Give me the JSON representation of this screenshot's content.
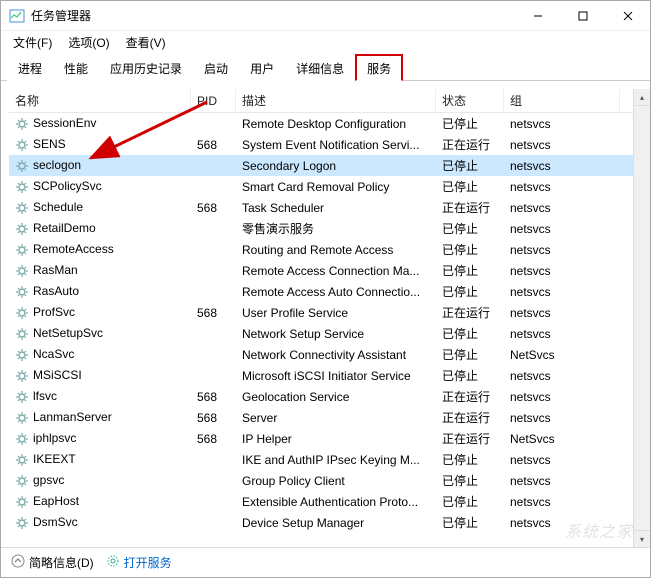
{
  "window": {
    "title": "任务管理器"
  },
  "menubar": {
    "file": "文件(F)",
    "options": "选项(O)",
    "view": "查看(V)"
  },
  "tabs": {
    "process": "进程",
    "performance": "性能",
    "apphistory": "应用历史记录",
    "startup": "启动",
    "users": "用户",
    "details": "详细信息",
    "services": "服务"
  },
  "columns": {
    "name": "名称",
    "pid": "PID",
    "desc": "描述",
    "status": "状态",
    "group": "组"
  },
  "services": [
    {
      "name": "SessionEnv",
      "pid": "",
      "desc": "Remote Desktop Configuration",
      "status": "已停止",
      "group": "netsvcs"
    },
    {
      "name": "SENS",
      "pid": "568",
      "desc": "System Event Notification Servi...",
      "status": "正在运行",
      "group": "netsvcs"
    },
    {
      "name": "seclogon",
      "pid": "",
      "desc": "Secondary Logon",
      "status": "已停止",
      "group": "netsvcs",
      "selected": true
    },
    {
      "name": "SCPolicySvc",
      "pid": "",
      "desc": "Smart Card Removal Policy",
      "status": "已停止",
      "group": "netsvcs"
    },
    {
      "name": "Schedule",
      "pid": "568",
      "desc": "Task Scheduler",
      "status": "正在运行",
      "group": "netsvcs"
    },
    {
      "name": "RetailDemo",
      "pid": "",
      "desc": "零售演示服务",
      "status": "已停止",
      "group": "netsvcs"
    },
    {
      "name": "RemoteAccess",
      "pid": "",
      "desc": "Routing and Remote Access",
      "status": "已停止",
      "group": "netsvcs"
    },
    {
      "name": "RasMan",
      "pid": "",
      "desc": "Remote Access Connection Ma...",
      "status": "已停止",
      "group": "netsvcs"
    },
    {
      "name": "RasAuto",
      "pid": "",
      "desc": "Remote Access Auto Connectio...",
      "status": "已停止",
      "group": "netsvcs"
    },
    {
      "name": "ProfSvc",
      "pid": "568",
      "desc": "User Profile Service",
      "status": "正在运行",
      "group": "netsvcs"
    },
    {
      "name": "NetSetupSvc",
      "pid": "",
      "desc": "Network Setup Service",
      "status": "已停止",
      "group": "netsvcs"
    },
    {
      "name": "NcaSvc",
      "pid": "",
      "desc": "Network Connectivity Assistant",
      "status": "已停止",
      "group": "NetSvcs"
    },
    {
      "name": "MSiSCSI",
      "pid": "",
      "desc": "Microsoft iSCSI Initiator Service",
      "status": "已停止",
      "group": "netsvcs"
    },
    {
      "name": "lfsvc",
      "pid": "568",
      "desc": "Geolocation Service",
      "status": "正在运行",
      "group": "netsvcs"
    },
    {
      "name": "LanmanServer",
      "pid": "568",
      "desc": "Server",
      "status": "正在运行",
      "group": "netsvcs"
    },
    {
      "name": "iphlpsvc",
      "pid": "568",
      "desc": "IP Helper",
      "status": "正在运行",
      "group": "NetSvcs"
    },
    {
      "name": "IKEEXT",
      "pid": "",
      "desc": "IKE and AuthIP IPsec Keying M...",
      "status": "已停止",
      "group": "netsvcs"
    },
    {
      "name": "gpsvc",
      "pid": "",
      "desc": "Group Policy Client",
      "status": "已停止",
      "group": "netsvcs"
    },
    {
      "name": "EapHost",
      "pid": "",
      "desc": "Extensible Authentication Proto...",
      "status": "已停止",
      "group": "netsvcs"
    },
    {
      "name": "DsmSvc",
      "pid": "",
      "desc": "Device Setup Manager",
      "status": "已停止",
      "group": "netsvcs"
    }
  ],
  "statusbar": {
    "fewer": "简略信息(D)",
    "open_services": "打开服务"
  },
  "watermark": "系统之家"
}
